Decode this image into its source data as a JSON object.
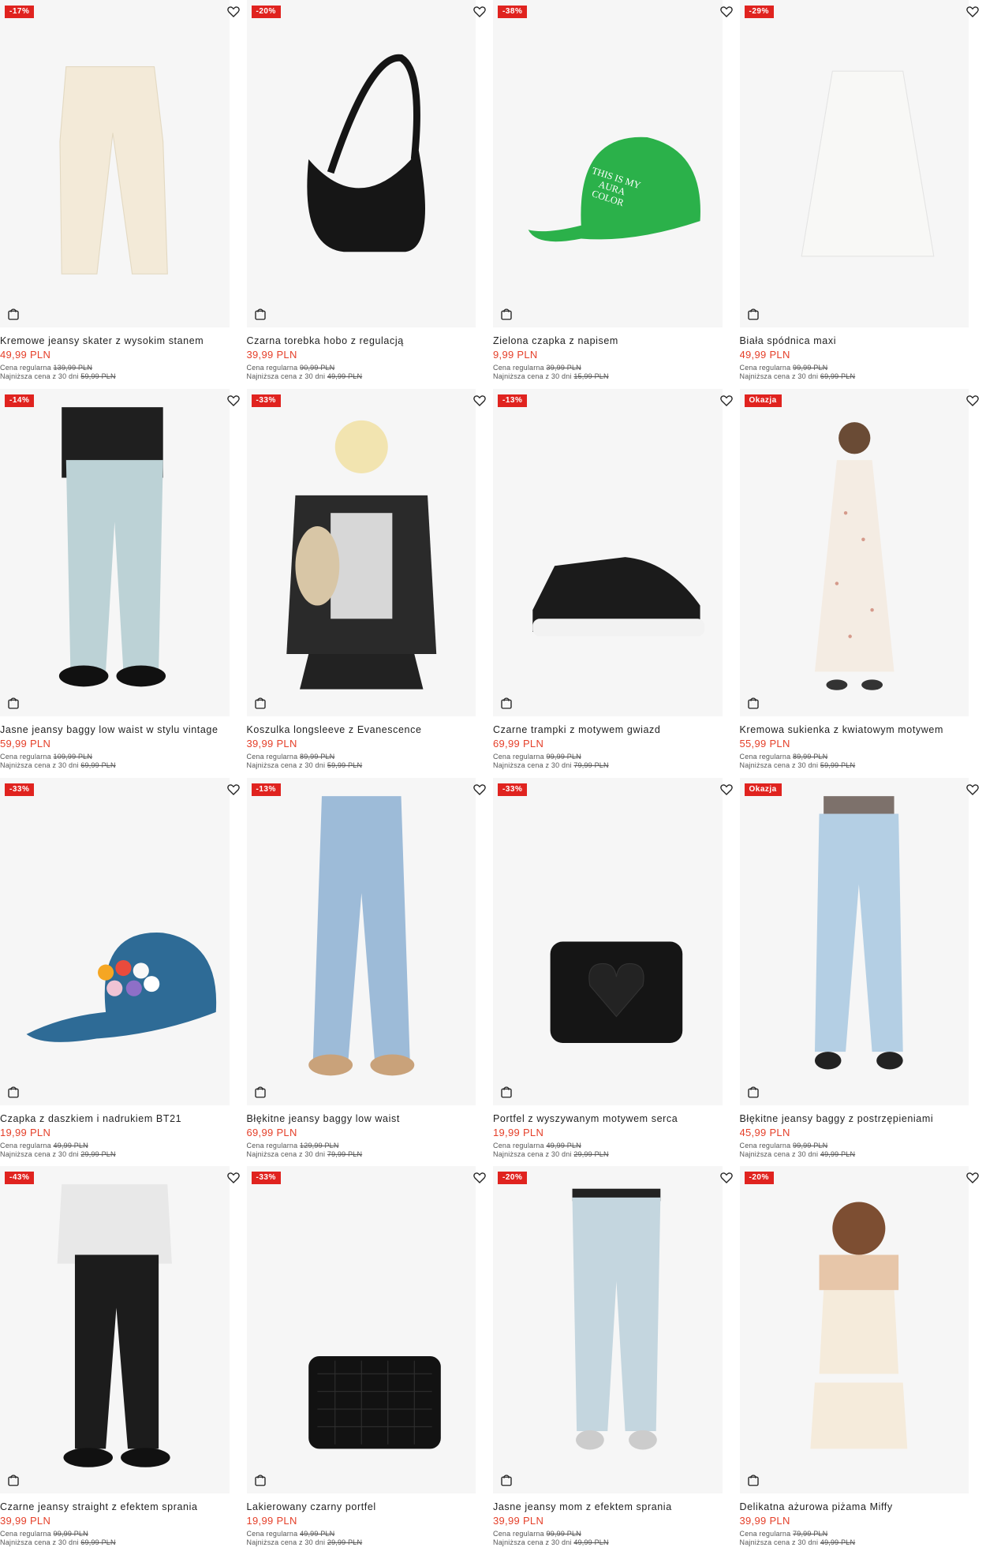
{
  "labels": {
    "regular_prefix": "Cena regularna",
    "lowest_prefix": "Najniższa cena z 30 dni"
  },
  "colors": {
    "accent": "#e0231f",
    "price": "#e5402a"
  },
  "products": [
    {
      "badge": "-17%",
      "name": "Kremowe jeansy skater z wysokim stanem",
      "price": "49,99 PLN",
      "regular": "139,99 PLN",
      "lowest": "59,99 PLN",
      "image": "cream-jeans"
    },
    {
      "badge": "-20%",
      "name": "Czarna torebka hobo z regulacją",
      "price": "39,99 PLN",
      "regular": "90,99 PLN",
      "lowest": "49,99 PLN",
      "image": "black-hobo-bag"
    },
    {
      "badge": "-38%",
      "name": "Zielona czapka z napisem",
      "price": "9,99 PLN",
      "regular": "39,99 PLN",
      "lowest": "15,99 PLN",
      "image": "green-cap"
    },
    {
      "badge": "-29%",
      "name": "Biała spódnica maxi",
      "price": "49,99 PLN",
      "regular": "99,99 PLN",
      "lowest": "69,99 PLN",
      "image": "white-maxi-skirt"
    },
    {
      "badge": "-14%",
      "name": "Jasne jeansy baggy low waist w stylu vintage",
      "price": "59,99 PLN",
      "regular": "109,99 PLN",
      "lowest": "69,99 PLN",
      "image": "light-baggy-jeans"
    },
    {
      "badge": "-33%",
      "name": "Koszulka longsleeve z Evanescence",
      "price": "39,99 PLN",
      "regular": "89,99 PLN",
      "lowest": "59,99 PLN",
      "image": "evanescence-longsleeve"
    },
    {
      "badge": "-13%",
      "name": "Czarne trampki z motywem gwiazd",
      "price": "69,99 PLN",
      "regular": "99,99 PLN",
      "lowest": "79,99 PLN",
      "image": "black-star-sneakers"
    },
    {
      "badge": "Okazja",
      "name": "Kremowa sukienka z kwiatowym motywem",
      "price": "55,99 PLN",
      "regular": "89,99 PLN",
      "lowest": "59,99 PLN",
      "image": "floral-dress"
    },
    {
      "badge": "-33%",
      "name": "Czapka z daszkiem i nadrukiem BT21",
      "price": "19,99 PLN",
      "regular": "49,99 PLN",
      "lowest": "29,99 PLN",
      "image": "bt21-cap"
    },
    {
      "badge": "-13%",
      "name": "Błękitne jeansy baggy low waist",
      "price": "69,99 PLN",
      "regular": "129,99 PLN",
      "lowest": "79,99 PLN",
      "image": "blue-baggy-jeans"
    },
    {
      "badge": "-33%",
      "name": "Portfel z wyszywanym motywem serca",
      "price": "19,99 PLN",
      "regular": "49,99 PLN",
      "lowest": "29,99 PLN",
      "image": "heart-wallet"
    },
    {
      "badge": "Okazja",
      "name": "Błękitne jeansy baggy z postrzępieniami",
      "price": "45,99 PLN",
      "regular": "99,99 PLN",
      "lowest": "49,99 PLN",
      "image": "frayed-baggy-jeans"
    },
    {
      "badge": "-43%",
      "name": "Czarne jeansy straight z efektem sprania",
      "price": "39,99 PLN",
      "regular": "99,99 PLN",
      "lowest": "69,99 PLN",
      "image": "black-straight-jeans"
    },
    {
      "badge": "-33%",
      "name": "Lakierowany czarny portfel",
      "price": "19,99 PLN",
      "regular": "49,99 PLN",
      "lowest": "29,99 PLN",
      "image": "croc-wallet"
    },
    {
      "badge": "-20%",
      "name": "Jasne jeansy mom z efektem sprania",
      "price": "39,99 PLN",
      "regular": "99,99 PLN",
      "lowest": "49,99 PLN",
      "image": "mom-jeans"
    },
    {
      "badge": "-20%",
      "name": "Delikatna ażurowa piżama Miffy",
      "price": "39,99 PLN",
      "regular": "79,99 PLN",
      "lowest": "49,99 PLN",
      "image": "miffy-pajama"
    }
  ]
}
